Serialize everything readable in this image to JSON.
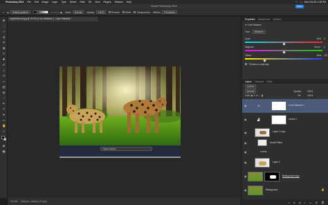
{
  "menubar": {
    "app": "Photoshop 2024",
    "items": [
      "File",
      "Edit",
      "Image",
      "Layer",
      "Type",
      "Select",
      "Filter",
      "3D",
      "View",
      "Plugins",
      "Window",
      "Help"
    ],
    "clock": "Mon Oct 23 1:48 PM"
  },
  "window": {
    "title": "Adobe Photoshop 2024",
    "share_label": "Share"
  },
  "options": {
    "preset": "Classic gradient",
    "mode_label": "Mode:",
    "mode_value": "Normal",
    "opacity_label": "Opacity:",
    "opacity_value": "100%",
    "reverse_label": "Reverse",
    "dither_label": "Dither",
    "transparency_label": "Transparency",
    "method_label": "Method:",
    "method_value": "Perceptual"
  },
  "document": {
    "tab_label": "amphibiekind.jpg @ 33.3% (Color Balance 1, Layer Mask/8) *",
    "zoom": "33.33%",
    "dimensions": "2048 px x 1365 px (72 ppi)"
  },
  "contextual_bar": {
    "label": "Select subject"
  },
  "properties": {
    "tabs": [
      "Properties",
      "Adjustments",
      "Libraries"
    ],
    "title": "Color Balance",
    "tone_label": "Tone:",
    "tone_value": "Midtones",
    "sliders": [
      {
        "left": "Cyan",
        "right": "Red",
        "value": "0",
        "position": 0.5
      },
      {
        "left": "Magenta",
        "right": "Green",
        "value": "0",
        "position": 0.5
      },
      {
        "left": "Yellow",
        "right": "Blue",
        "value": "-56",
        "position": 0.25
      }
    ],
    "preserve_label": "Preserve Luminosity"
  },
  "layers_panel": {
    "tabs": [
      "Layers",
      "Channels",
      "Paths"
    ],
    "kind_label": "Q Kind",
    "blend_mode": "Normal",
    "opacity_label": "Opacity:",
    "opacity_value": "100%",
    "lock_label": "Lock:",
    "fill_label": "Fill:",
    "fill_value": "100%",
    "layers": [
      {
        "name": "Color Balance 1",
        "selected": true
      },
      {
        "name": "Levels 1",
        "selected": false
      },
      {
        "name": "Layer 1 copy",
        "selected": false
      },
      {
        "name": "Smart Filters",
        "selected": false
      },
      {
        "name": "Levels",
        "selected": false
      },
      {
        "name": "Layer 1",
        "selected": false
      },
      {
        "name": "Background copy",
        "selected": false
      },
      {
        "name": "Background",
        "selected": false
      }
    ]
  },
  "colors": {
    "accent": "#2680eb",
    "selected_layer": "#4a5a78"
  }
}
